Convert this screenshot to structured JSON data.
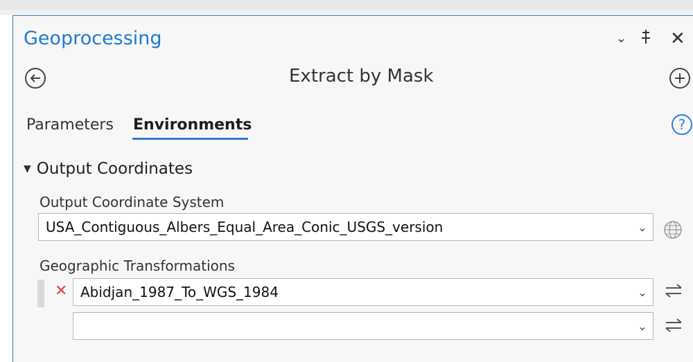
{
  "panel": {
    "title": "Geoprocessing",
    "controls": {
      "collapse": "⌄",
      "pin": "ꟸ",
      "close": "✕"
    }
  },
  "tool": {
    "title": "Extract by Mask",
    "back_icon": "arrow-left-icon",
    "add_icon": "plus-icon"
  },
  "tabs": [
    {
      "label": "Parameters",
      "active": false
    },
    {
      "label": "Environments",
      "active": true
    }
  ],
  "help_icon": "?",
  "section": {
    "label": "Output Coordinates",
    "expanded": true
  },
  "output_coordinate_system": {
    "label": "Output Coordinate System",
    "value": "USA_Contiguous_Albers_Equal_Area_Conic_USGS_version",
    "icon": "globe-icon"
  },
  "geographic_transformations": {
    "label": "Geographic Transformations",
    "rows": [
      {
        "value": "Abidjan_1987_To_WGS_1984",
        "removable": true
      },
      {
        "value": "",
        "removable": false
      }
    ],
    "swap_icon": "swap-arrows-icon"
  },
  "colors": {
    "accent": "#2d7fd1",
    "remove": "#e04040"
  }
}
